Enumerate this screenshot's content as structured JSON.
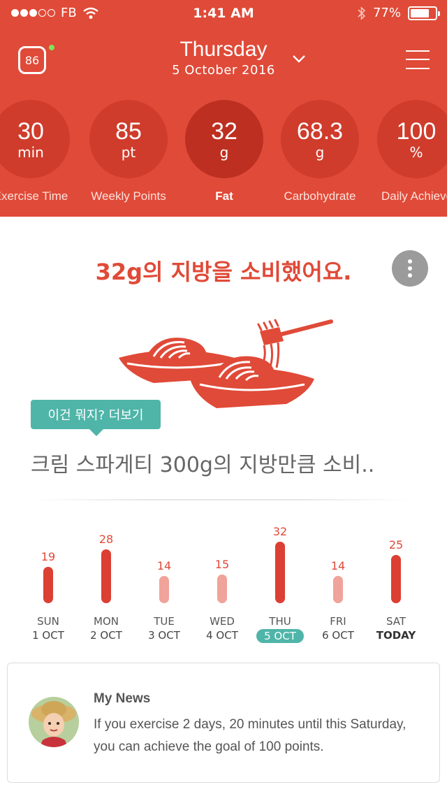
{
  "status_bar": {
    "carrier": "FB",
    "time": "1:41 AM",
    "battery": "77%",
    "battery_level": 0.77
  },
  "header": {
    "score": "86",
    "day_name": "Thursday",
    "date": "5 October 2016",
    "stats": [
      {
        "value": "30",
        "unit": "min",
        "label": "Exercise Time"
      },
      {
        "value": "85",
        "unit": "pt",
        "label": "Weekly Points"
      },
      {
        "value": "32",
        "unit": "g",
        "label": "Fat"
      },
      {
        "value": "68.3",
        "unit": "g",
        "label": "Carbohydrate"
      },
      {
        "value": "100",
        "unit": "%",
        "label": "Daily Achievement"
      }
    ]
  },
  "main": {
    "headline": "32g의 지방을 소비했어요.",
    "tooltip": "이건 뭐지? 더보기",
    "comparison": "크림 스파게티 300g의 지방만큼 소비.."
  },
  "week": {
    "days": [
      {
        "value": 19,
        "label": "19",
        "name": "SUN",
        "date": "1 OCT"
      },
      {
        "value": 28,
        "label": "28",
        "name": "MON",
        "date": "2 OCT"
      },
      {
        "value": 14,
        "label": "14",
        "name": "TUE",
        "date": "3 OCT"
      },
      {
        "value": 15,
        "label": "15",
        "name": "WED",
        "date": "4 OCT"
      },
      {
        "value": 32,
        "label": "32",
        "name": "THU",
        "date": "5 OCT"
      },
      {
        "value": 14,
        "label": "14",
        "name": "FRI",
        "date": "6 OCT"
      },
      {
        "value": 25,
        "label": "25",
        "name": "SAT",
        "date": "TODAY"
      }
    ],
    "selected_index": 4,
    "today_index": 6
  },
  "news": {
    "title": "My News",
    "body": "If you exercise 2 days, 20 minutes until this Saturday, you can achieve the goal of 100 points."
  },
  "colors": {
    "accent": "#e04a38",
    "teal": "#4fb5a8",
    "bar_high": "#dc3f33",
    "bar_low": "#f0a39a"
  }
}
